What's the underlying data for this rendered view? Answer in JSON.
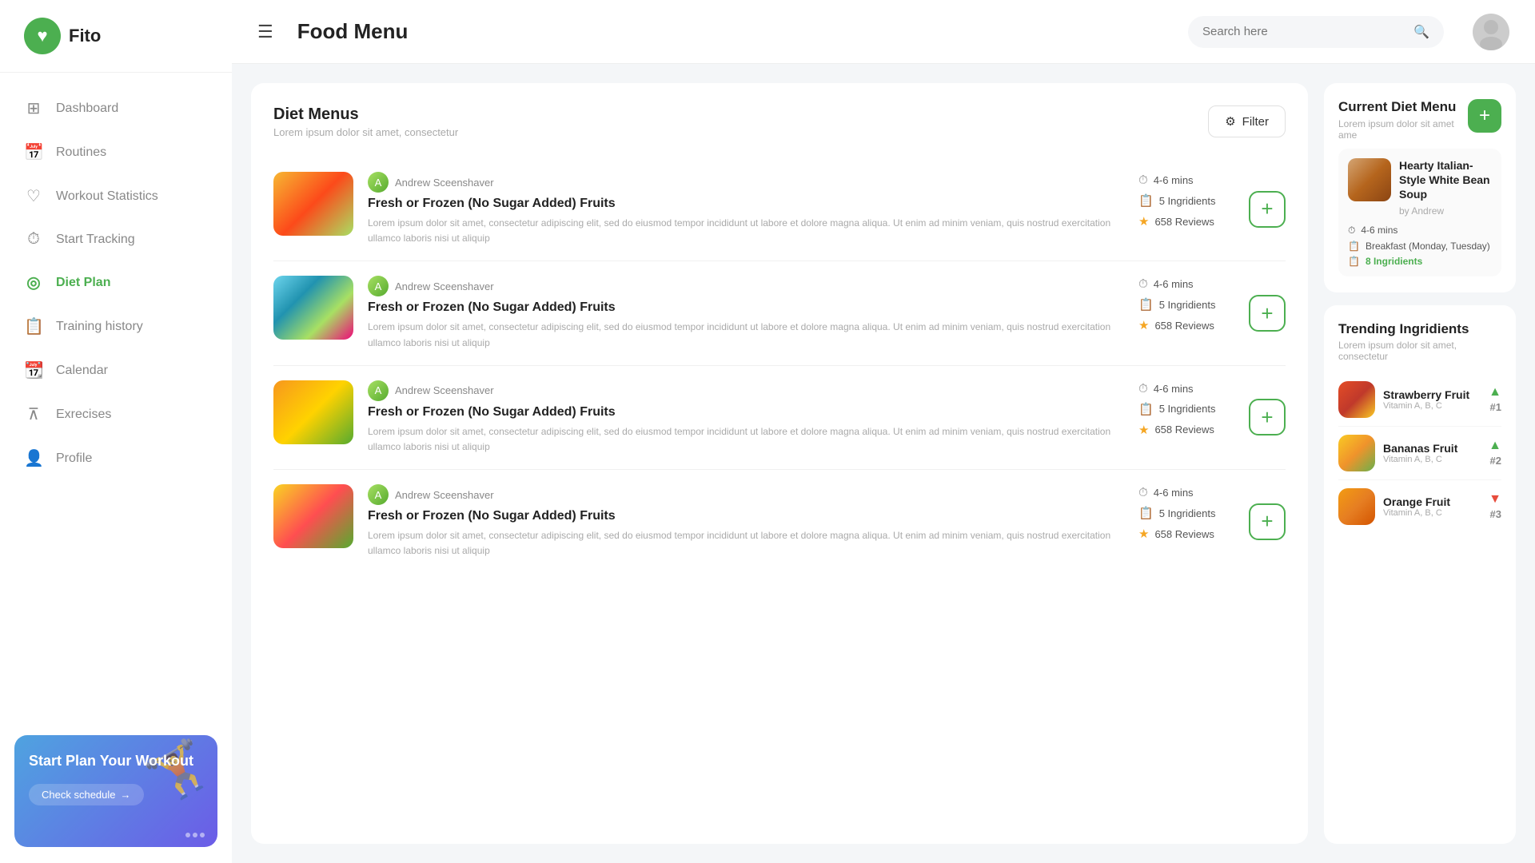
{
  "app": {
    "logo_text": "Fito",
    "logo_icon": "♥"
  },
  "sidebar": {
    "nav_items": [
      {
        "id": "dashboard",
        "label": "Dashboard",
        "icon": "⊞",
        "active": false
      },
      {
        "id": "routines",
        "label": "Routines",
        "icon": "📅",
        "active": false
      },
      {
        "id": "workout-statistics",
        "label": "Workout Statistics",
        "icon": "♡",
        "active": false
      },
      {
        "id": "start-tracking",
        "label": "Start Tracking",
        "icon": "⏱",
        "active": false
      },
      {
        "id": "diet-plan",
        "label": "Diet Plan",
        "icon": "◎",
        "active": true
      },
      {
        "id": "training-history",
        "label": "Training history",
        "icon": "📋",
        "active": false
      },
      {
        "id": "calendar",
        "label": "Calendar",
        "icon": "📆",
        "active": false
      },
      {
        "id": "exercises",
        "label": "Exrecises",
        "icon": "⊼",
        "active": false
      },
      {
        "id": "profile",
        "label": "Profile",
        "icon": "👤",
        "active": false
      }
    ],
    "promo": {
      "title": "Start Plan Your Workout",
      "link_text": "Check schedule",
      "link_arrow": "→"
    }
  },
  "header": {
    "menu_icon": "☰",
    "title": "Food Menu",
    "search_placeholder": "Search here"
  },
  "main": {
    "section_title": "Diet Menus",
    "section_subtitle": "Lorem ipsum dolor sit amet, consectetur",
    "filter_label": "Filter",
    "cards": [
      {
        "id": 1,
        "author": "Andrew Sceenshaver",
        "title": "Fresh or Frozen (No Sugar Added) Fruits",
        "description": "Lorem ipsum dolor sit amet, consectetur adipiscing elit, sed do eiusmod tempor incididunt ut labore et dolore magna aliqua. Ut enim ad minim veniam, quis nostrud exercitation ullamco laboris nisi ut aliquip",
        "time": "4-6 mins",
        "ingredients": "5 Ingridients",
        "reviews": "658 Reviews",
        "img_class": "img-fruits-1"
      },
      {
        "id": 2,
        "author": "Andrew Sceenshaver",
        "title": "Fresh or Frozen (No Sugar Added) Fruits",
        "description": "Lorem ipsum dolor sit amet, consectetur adipiscing elit, sed do eiusmod tempor incididunt ut labore et dolore magna aliqua. Ut enim ad minim veniam, quis nostrud exercitation ullamco laboris nisi ut aliquip",
        "time": "4-6 mins",
        "ingredients": "5 Ingridients",
        "reviews": "658 Reviews",
        "img_class": "img-fruits-2"
      },
      {
        "id": 3,
        "author": "Andrew Sceenshaver",
        "title": "Fresh or Frozen (No Sugar Added) Fruits",
        "description": "Lorem ipsum dolor sit amet, consectetur adipiscing elit, sed do eiusmod tempor incididunt ut labore et dolore magna aliqua. Ut enim ad minim veniam, quis nostrud exercitation ullamco laboris nisi ut aliquip",
        "time": "4-6 mins",
        "ingredients": "5 Ingridients",
        "reviews": "658 Reviews",
        "img_class": "img-vegs-1"
      },
      {
        "id": 4,
        "author": "Andrew Sceenshaver",
        "title": "Fresh or Frozen (No Sugar Added) Fruits",
        "description": "Lorem ipsum dolor sit amet, consectetur adipiscing elit, sed do eiusmod tempor incididunt ut labore et dolore magna aliqua. Ut enim ad minim veniam, quis nostrud exercitation ullamco laboris nisi ut aliquip",
        "time": "4-6 mins",
        "ingredients": "5 Ingridients",
        "reviews": "658 Reviews",
        "img_class": "img-fruits-4"
      }
    ]
  },
  "right_panel": {
    "current_diet": {
      "title": "Current Diet Menu",
      "subtitle": "Lorem ipsum dolor sit amet",
      "subtitle2": "ame",
      "item": {
        "name": "Hearty Italian- Style White Bean Soup",
        "by": "by Andrew",
        "time": "4-6 mins",
        "meal": "Breakfast (Monday, Tuesday)",
        "ingredients": "8 Ingridients",
        "img_class": "img-soup"
      }
    },
    "trending": {
      "title": "Trending Ingridients",
      "subtitle": "Lorem ipsum dolor sit amet, consectetur",
      "items": [
        {
          "name": "Strawberry Fruit",
          "vitamins": "Vitamin A, B, C",
          "trend": "up",
          "rank": "#1",
          "img_class": "img-strawberry"
        },
        {
          "name": "Bananas Fruit",
          "vitamins": "Vitamin A, B, C",
          "trend": "up",
          "rank": "#2",
          "img_class": "img-banana"
        },
        {
          "name": "Orange Fruit",
          "vitamins": "Vitamin A, B, C",
          "trend": "down",
          "rank": "#3",
          "img_class": "img-orange"
        }
      ]
    }
  }
}
